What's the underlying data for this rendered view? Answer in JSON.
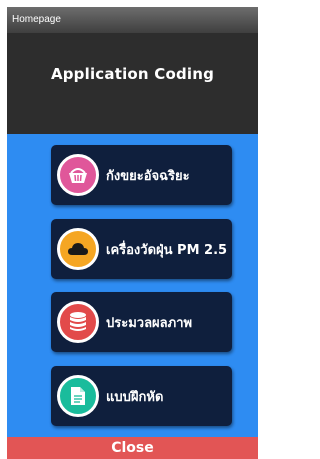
{
  "window": {
    "title": "Homepage"
  },
  "header": {
    "title": "Application Coding"
  },
  "menu": {
    "items": [
      {
        "label": "กังขยะอัจฉริยะ",
        "icon": "basket-icon",
        "icon_color": "#e0579a"
      },
      {
        "label": "เครื่องวัดฝุ่น PM 2.5",
        "icon": "cloud-icon",
        "icon_color": "#f5a623"
      },
      {
        "label": "ประมวลผลภาพ",
        "icon": "database-icon",
        "icon_color": "#e24a4a"
      },
      {
        "label": "แบบฝึกหัด",
        "icon": "document-icon",
        "icon_color": "#1abc9c"
      }
    ]
  },
  "footer": {
    "close_label": "Close"
  },
  "colors": {
    "background": "#2e8cf2",
    "header": "#2d2d2d",
    "button": "#0f1f3d",
    "close": "#e25555"
  }
}
